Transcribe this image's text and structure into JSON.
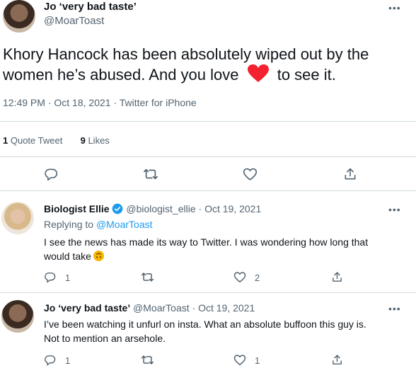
{
  "main_tweet": {
    "author_name": "Jo ‘very bad taste’",
    "handle": "@MoarToast",
    "text_before_emoji": "Khory Hancock has been absolutely wiped out by the women he’s abused. And you love ",
    "emoji": "red-heart",
    "text_after_emoji": " to see it.",
    "time": "12:49 PM",
    "date": "Oct 18, 2021",
    "client": "Twitter for iPhone",
    "quote_count": "1",
    "quote_label": "Quote Tweet",
    "like_count": "9",
    "like_label": "Likes",
    "sep": " · "
  },
  "replies": [
    {
      "author_name": "Biologist Ellie",
      "verified": true,
      "handle": "@biologist_ellie",
      "sep": " · ",
      "date": "Oct 19, 2021",
      "replying_prefix": "Replying to ",
      "replying_to": "@MoarToast",
      "text_line1": "I see the news has made its way to Twitter. I was wondering how long that",
      "text_line2": "would take",
      "emoji": "upside-down-face",
      "reply_count": "1",
      "like_count": "2"
    },
    {
      "author_name": "Jo ‘very bad taste’",
      "handle": "@MoarToast",
      "sep": " · ",
      "date": "Oct 19, 2021",
      "text_line1": "I’ve been watching it unfurl on insta. What an absolute buffoon this guy is.",
      "text_line2": "Not to mention an arsehole.",
      "reply_count": "1",
      "like_count": "1"
    }
  ],
  "more_glyph": "•••",
  "colors": {
    "text": "#0f1419",
    "muted": "#536471",
    "link": "#1d9bf0",
    "divider": "#cfd9de",
    "heart": "#f4212e",
    "verified": "#1d9bf0"
  }
}
